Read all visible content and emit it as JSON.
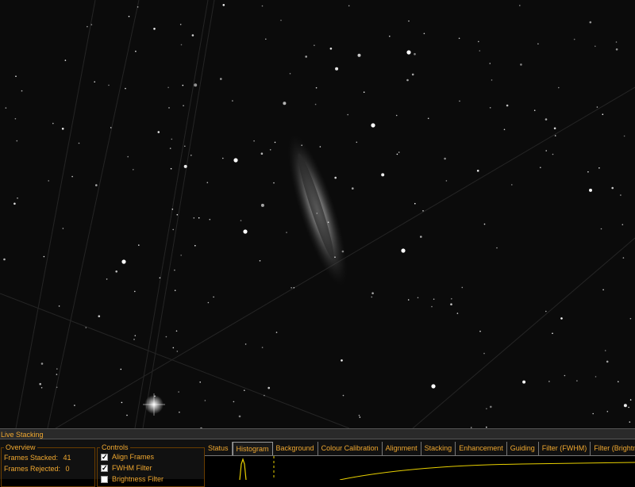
{
  "panel": {
    "title": "Live Stacking",
    "overview": {
      "legend": "Overview",
      "frames_stacked_label": "Frames Stacked:",
      "frames_stacked_value": "41",
      "frames_rejected_label": "Frames Rejected:",
      "frames_rejected_value": "0"
    },
    "controls": {
      "legend": "Controls",
      "align_frames": {
        "label": "Align Frames",
        "checked": true
      },
      "fwhm_filter": {
        "label": "FWHM Filter",
        "checked": true
      },
      "brightness_filter": {
        "label": "Brightness Filter",
        "checked": false
      }
    },
    "tabs": [
      {
        "label": "Status",
        "active": false
      },
      {
        "label": "Histogram",
        "active": true
      },
      {
        "label": "Background",
        "active": false
      },
      {
        "label": "Colour Calibration",
        "active": false
      },
      {
        "label": "Alignment",
        "active": false
      },
      {
        "label": "Stacking",
        "active": false
      },
      {
        "label": "Enhancement",
        "active": false
      },
      {
        "label": "Guiding",
        "active": false
      },
      {
        "label": "Filter (FWHM)",
        "active": false
      },
      {
        "label": "Filter (Brightness)",
        "active": false
      }
    ]
  },
  "colors": {
    "accent": "#f0a830",
    "border": "#6a3d00",
    "histogram": "#e8d000"
  }
}
